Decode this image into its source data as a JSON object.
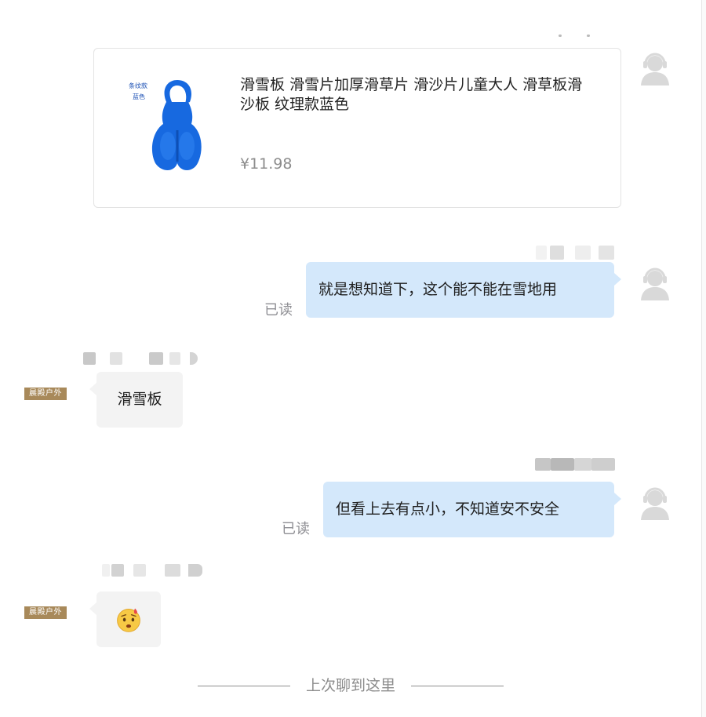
{
  "product": {
    "title": "滑雪板 滑雪片加厚滑草片 滑沙片儿童大人 滑草板滑沙板 纹理款蓝色",
    "price": "¥11.98",
    "image_label_line1": "条纹款",
    "image_label_line2": "蓝色",
    "image_color": "#1769e0"
  },
  "messages": [
    {
      "direction": "out",
      "text": "就是想知道下，这个能不能在雪地用",
      "status": "已读"
    },
    {
      "direction": "in",
      "text": "滑雪板",
      "store_badge": "晨殿户外"
    },
    {
      "direction": "out",
      "text": "但看上去有点小，不知道安不安全",
      "status": "已读"
    },
    {
      "direction": "in",
      "emoji": "worried-face",
      "store_badge": "晨殿户外"
    }
  ],
  "divider": {
    "text": "上次聊到这里"
  },
  "colors": {
    "out_bubble": "#d4e8fb",
    "in_bubble": "#f3f3f3",
    "store_badge": "#a8895a",
    "avatar": "#d9d9d9"
  },
  "icons": {
    "avatar": "user-headset-avatar-icon",
    "emoji": "worried-face-emoji-icon"
  }
}
